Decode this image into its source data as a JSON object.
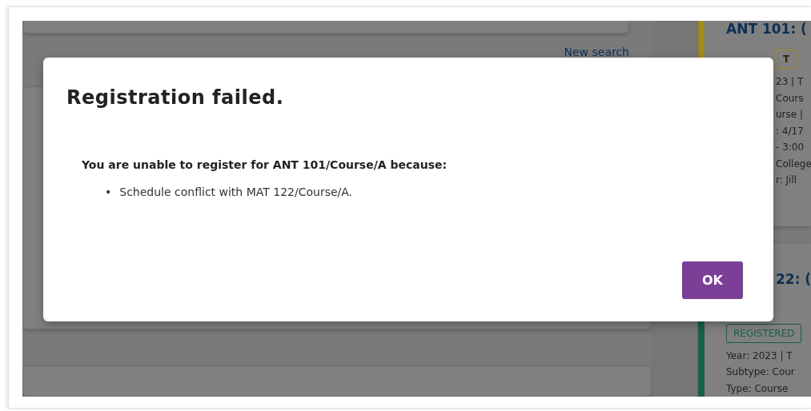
{
  "background": {
    "link": "New search",
    "cards": [
      {
        "title": "ANT 101: (",
        "color": "#a38a1f",
        "badge": "T",
        "lines": [
          "23 | T",
          "Cours",
          "urse |",
          ": 4/17",
          "- 3:00",
          "College",
          "r: Jill"
        ]
      },
      {
        "title": "22: (",
        "color": "#17604a",
        "badge": "REGISTERED",
        "lines": [
          "Year: 2023 | T",
          "Subtype: Cour",
          "Type: Course"
        ]
      }
    ]
  },
  "dialog": {
    "title": "Registration failed.",
    "message": "You are unable to register for ANT 101/Course/A because:",
    "bullet": "•",
    "reasons": [
      "Schedule conflict with MAT 122/Course/A."
    ],
    "button": "OK"
  }
}
